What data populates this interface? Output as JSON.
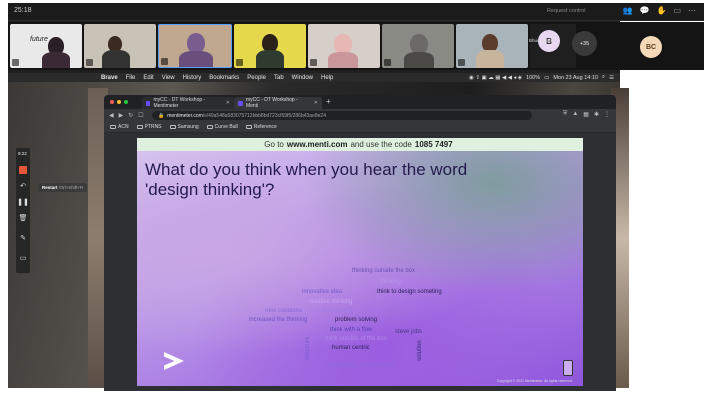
{
  "teams": {
    "time": "25:18",
    "request_control": "Request control",
    "bhuvan_name": "Bhuvanyahi...",
    "overflow_count": "+35",
    "avatar_b": "B",
    "self_initials": "BC"
  },
  "menubar": {
    "app": "Brave",
    "items": [
      "File",
      "Edit",
      "View",
      "History",
      "Bookmarks",
      "People",
      "Tab",
      "Window",
      "Help"
    ],
    "status": "100%",
    "datetime": "Mon 23 Aug 14:10"
  },
  "zoom_toolbar": {
    "time": "9:22",
    "tooltip_label": "Restart",
    "tooltip_shortcut": "Ctrl+Shift+R"
  },
  "browser": {
    "tabs": [
      {
        "label": "myCC - DT Workshop - Mentimeter"
      },
      {
        "label": "myCC - DT Workshop - Menti"
      }
    ],
    "url_host": "mentimeter.com",
    "url_path": "/s/49a548a583075712bbb8bd723cf69f5/286b43ae8e24",
    "bookmarks": [
      "ACN",
      "PTRNS",
      "Samsung",
      "Curve Ball",
      "Reference"
    ]
  },
  "slide": {
    "code_prefix": "Go to",
    "code_site": "www.menti.com",
    "code_mid": "and use the code",
    "code_number": "1085 7497",
    "question_line1": "What do you think when you hear the word",
    "question_line2": "'design thinking'?",
    "words": [
      "thinking outside the box",
      "thinking",
      "innovative idea",
      "think to design someting",
      "creative thinking",
      "new creations",
      "user centric",
      "increased the thinking",
      "problem solving",
      "think with a flow",
      "steve jobs",
      "think outside of the box",
      "human centric",
      "something out of the box",
      "structure",
      "solution"
    ],
    "copyright": "Copyright © 2021 Mentimeter. All rights reserved."
  }
}
